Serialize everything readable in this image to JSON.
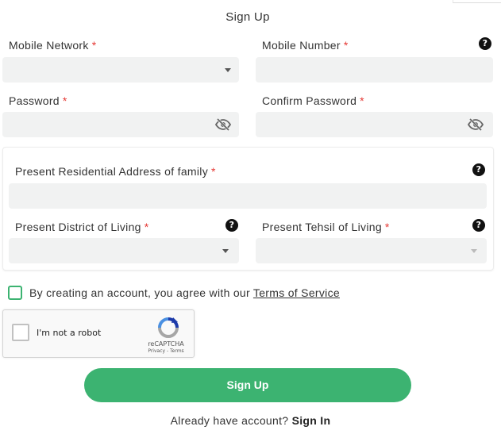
{
  "title": "Sign Up",
  "required_mark": "*",
  "help_glyph": "?",
  "fields": {
    "mobile_network": {
      "label": "Mobile Network",
      "value": ""
    },
    "mobile_number": {
      "label": "Mobile Number",
      "value": ""
    },
    "password": {
      "label": "Password",
      "value": ""
    },
    "confirm_password": {
      "label": "Confirm Password",
      "value": ""
    },
    "address": {
      "label": "Present Residential Address of family",
      "value": ""
    },
    "district": {
      "label": "Present District of Living",
      "value": ""
    },
    "tehsil": {
      "label": "Present Tehsil of Living",
      "value": ""
    }
  },
  "agreement": {
    "text": "By creating an account, you agree with our ",
    "link": "Terms of Service",
    "checked": false
  },
  "recaptcha": {
    "label": "I'm not a robot",
    "brand": "reCAPTCHA",
    "links": "Privacy - Terms"
  },
  "signup_button": "Sign Up",
  "footer": {
    "prompt": "Already have account? ",
    "link": "Sign In"
  },
  "colors": {
    "accent": "#3cb371",
    "required": "#e53935",
    "field_bg": "#f1f2f2"
  },
  "icons": {
    "help": "question-circle-icon",
    "password_toggle": "eye-slash-icon",
    "dropdown": "caret-down-icon"
  }
}
